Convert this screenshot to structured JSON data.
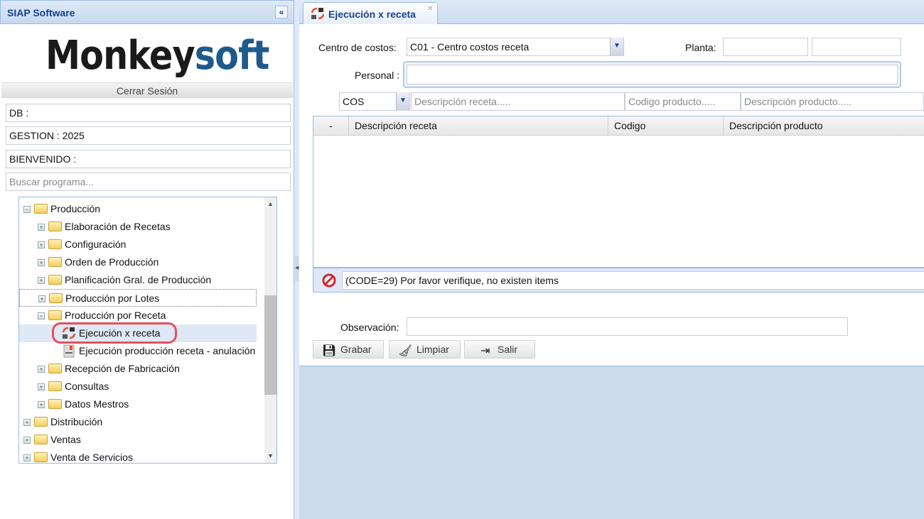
{
  "app": {
    "title": "SIAP Software",
    "collapse_icon": "double-chevron-left-icon"
  },
  "logo": {
    "text_dark": "Monkey",
    "text_blue": "soft"
  },
  "logout": "Cerrar Sesión",
  "info": {
    "db": "DB :",
    "gestion": "GESTION : 2025",
    "bienvenido": "BIENVENIDO :"
  },
  "search": {
    "placeholder": "Buscar programa..."
  },
  "tree": [
    {
      "label": "Producción",
      "level": 0,
      "expanded": true
    },
    {
      "label": "Elaboración de Recetas",
      "level": 1
    },
    {
      "label": "Configuración",
      "level": 1
    },
    {
      "label": "Orden de Producción",
      "level": 1
    },
    {
      "label": "Planificación Gral. de Producción",
      "level": 1
    },
    {
      "label": "Producción por Lotes",
      "level": 1,
      "focused": true
    },
    {
      "label": "Producción por Receta",
      "level": 1,
      "expanded": true
    },
    {
      "label": "Ejecución x receta",
      "level": 2,
      "leaf": true,
      "selected": true
    },
    {
      "label": "Ejecución producción receta - anulación",
      "level": 2,
      "leaf": true
    },
    {
      "label": "Recepción de Fabricación",
      "level": 1
    },
    {
      "label": "Consultas",
      "level": 1
    },
    {
      "label": "Datos Mestros",
      "level": 1
    },
    {
      "label": "Distribución",
      "level": 0
    },
    {
      "label": "Ventas",
      "level": 0
    },
    {
      "label": "Venta de Servicios",
      "level": 0
    }
  ],
  "tab": {
    "label": "Ejecución x receta"
  },
  "form": {
    "centro_label": "Centro de costos:",
    "centro_value": "C01 - Centro costos receta",
    "planta_label": "Planta:",
    "planta_value1": "",
    "planta_value2": "",
    "personal_label": "Personal :",
    "personal_value": "",
    "filter_select": "COS",
    "filter_desc_receta": "Descripción receta.....",
    "filter_codigo": "Codigo producto.....",
    "filter_desc_producto": "Descripción producto.....",
    "observacion_label": "Observación:",
    "observacion_value": ""
  },
  "grid": {
    "columns": [
      "-",
      "Descripción receta",
      "Codigo",
      "Descripción producto"
    ],
    "rows": []
  },
  "message": {
    "icon": "error-icon",
    "text": "(CODE=29) Por favor verifique, no existen items",
    "color": "#d9232e"
  },
  "buttons": {
    "grabar": "Grabar",
    "limpiar": "Limpiar",
    "salir": "Salir"
  },
  "colors": {
    "accent": "#15428b",
    "highlight": "#e8505b"
  }
}
